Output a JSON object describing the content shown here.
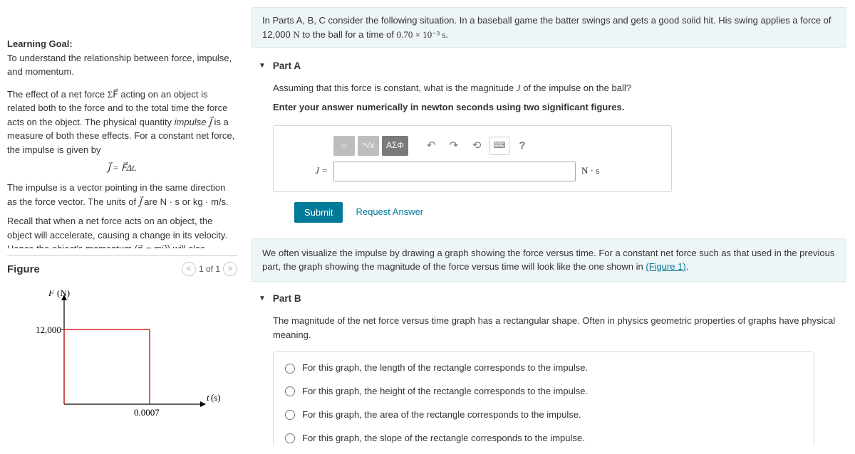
{
  "left": {
    "learning_goal_label": "Learning Goal:",
    "learning_goal_text": "To understand the relationship between force, impulse, and momentum.",
    "para1_a": "The effect of a net force ",
    "para1_sum": "ΣF⃗",
    "para1_b": " acting on an object is related both to the force and to the total time the force acts on the object. The physical quantity ",
    "para1_impulse_word": "impulse",
    "para1_c": " ",
    "para1_jvec": "J⃗",
    "para1_d": " is a measure of both these effects. For a constant net force, the impulse is given by",
    "eq1": "J⃗ = F⃗Δt.",
    "para2_a": "The impulse is a vector pointing in the same direction as the force vector. The units of ",
    "para2_jvec": "J⃗",
    "para2_b": " are N · s or kg · m/s.",
    "para3": "Recall that when a net force acts on an object, the object will accelerate, causing a change in its velocity. Hence the object's momentum (p⃗ = mv⃗) will also change. The",
    "figure_label": "Figure",
    "figure_nav": "1 of 1",
    "chart_data": {
      "type": "line",
      "xlabel": "t (s)",
      "ylabel": "F (N)",
      "x_tick": "0.0007",
      "y_tick": "12,000",
      "description": "rectangular pulse from t=0 to t=0.0007 at F=12000"
    }
  },
  "right": {
    "intro_a": "In Parts A, B, C consider the following situation. In a baseball game the batter swings and gets a good solid hit. His swing applies a force of 12,000 ",
    "intro_unit": "N",
    "intro_b": " to the ball for a time of ",
    "intro_time": "0.70 × 10⁻³ s",
    "intro_c": ".",
    "partA": {
      "label": "Part A",
      "q_a": "Assuming that this force is constant, what is the magnitude ",
      "q_J": "J",
      "q_b": " of the impulse on the ball?",
      "instruction": "Enter your answer numerically in newton seconds using two significant figures.",
      "greek_label": "ΑΣΦ",
      "lhs": "J =",
      "units": "N · s",
      "submit": "Submit",
      "request": "Request Answer"
    },
    "callout_a": "We often visualize the impulse by drawing a graph showing the force versus time. For a constant net force such as that used in the previous part, the graph showing the magnitude of the force versus time will look like the one shown in ",
    "callout_link": "(Figure 1)",
    "callout_b": ".",
    "partB": {
      "label": "Part B",
      "q": "The magnitude of the net force versus time graph has a rectangular shape. Often in physics geometric properties of graphs have physical meaning.",
      "options": [
        "For this graph, the length of the rectangle corresponds to the impulse.",
        "For this graph, the height of the rectangle corresponds to the impulse.",
        "For this graph, the area of the rectangle corresponds to the impulse.",
        "For this graph, the slope of the rectangle corresponds to the impulse."
      ]
    }
  }
}
